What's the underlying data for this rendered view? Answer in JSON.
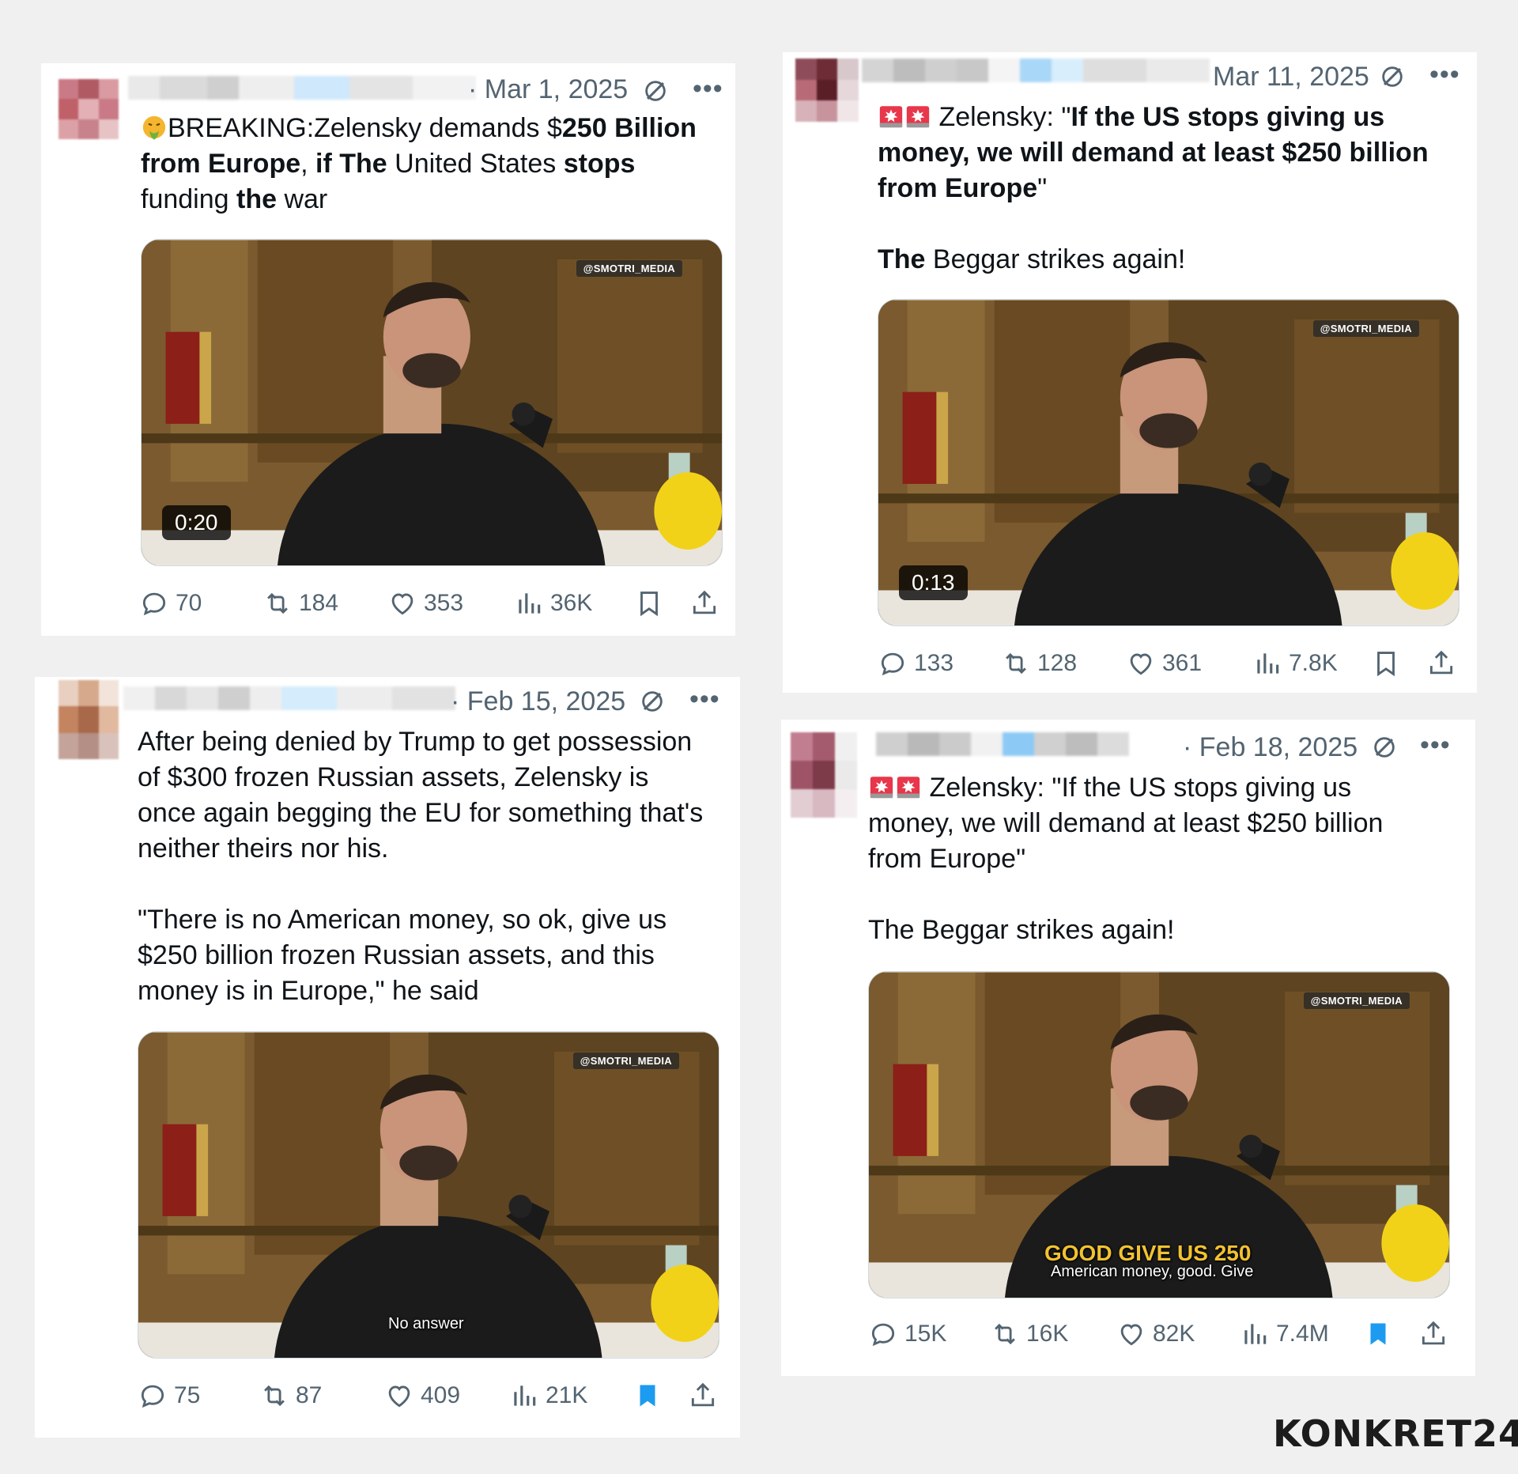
{
  "posts": [
    {
      "date": "· Mar 1, 2025",
      "text_html_parts": {
        "line1_a": "BREAKING:Zelensky demands $",
        "line1_b": "250 Billion",
        "line2_a": "from Europe",
        "line2_b": ", ",
        "line2_c": "if The",
        "line2_d": " United States ",
        "line2_e": "stops",
        "line3_a": "funding ",
        "line3_b": "the",
        "line3_c": " war"
      },
      "video": {
        "duration": "0:20",
        "watermark": "@SMOTRI_MEDIA"
      },
      "stats": {
        "replies": "70",
        "reposts": "184",
        "likes": "353",
        "views": "36K"
      },
      "bookmarked": false
    },
    {
      "date": "Mar 11, 2025",
      "text_html_parts": {
        "line1_a": "Zelensky: \"",
        "line1_b": "If the US stops giving us",
        "line2": "money, we will demand at least $250 billion",
        "line3_a": "from Europe",
        "line3_b": "\"",
        "line4_a": "The",
        "line4_b": " Beggar strikes again!"
      },
      "video": {
        "duration": "0:13",
        "watermark": "@SMOTRI_MEDIA"
      },
      "stats": {
        "replies": "133",
        "reposts": "128",
        "likes": "361",
        "views": "7.8K"
      },
      "bookmarked": false
    },
    {
      "date": "· Feb 15, 2025",
      "text": {
        "line1": "After being denied by Trump to get possession",
        "line2": "of $300 frozen Russian assets, Zelensky is",
        "line3": "once again begging the EU for something that's",
        "line4": "neither theirs nor his.",
        "line5": "\"There is no American money, so ok, give us",
        "line6": "$250 billion frozen Russian assets, and this",
        "line7": "money is in Europe,\" he said"
      },
      "video": {
        "caption": "No answer",
        "watermark": "@SMOTRI_MEDIA"
      },
      "stats": {
        "replies": "75",
        "reposts": "87",
        "likes": "409",
        "views": "21K"
      },
      "bookmarked": true
    },
    {
      "date": "· Feb 18, 2025",
      "text": {
        "line1": "Zelensky: \"If the US stops giving us",
        "line2": "money, we will demand at least $250 billion",
        "line3": "from Europe\"",
        "line4": "The Beggar strikes again!"
      },
      "video": {
        "caption_top": "GOOD GIVE US 250",
        "caption": "American money, good. Give",
        "watermark": "@SMOTRI_MEDIA"
      },
      "stats": {
        "replies": "15K",
        "reposts": "16K",
        "likes": "82K",
        "views": "7.4M"
      },
      "bookmarked": true
    }
  ],
  "brand": {
    "logo_text": "KONKRET24"
  },
  "colors": {
    "text": "#0f1419",
    "muted": "#536471",
    "accent": "#1d9bf0",
    "siren": "#e0245e"
  }
}
